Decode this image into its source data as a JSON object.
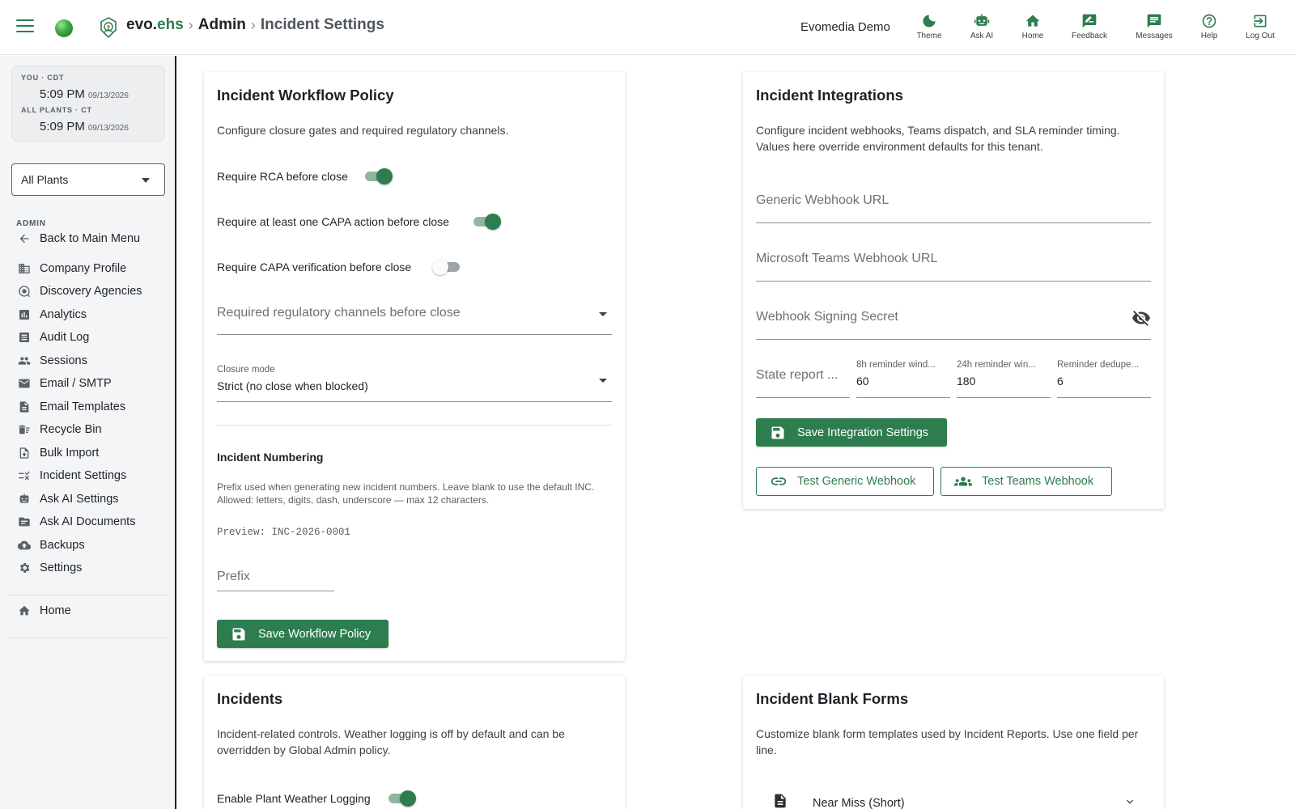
{
  "header": {
    "brand_prefix": "evo.",
    "brand_suffix": "ehs",
    "sep": "›",
    "crumb_admin": "Admin",
    "crumb_page": "Incident Settings",
    "tenant": "Evomedia Demo",
    "nav": [
      {
        "label": "Theme",
        "icon": "moon-icon"
      },
      {
        "label": "Ask AI",
        "icon": "robot-icon"
      },
      {
        "label": "Home",
        "icon": "home-icon"
      },
      {
        "label": "Feedback",
        "icon": "feedback-icon"
      },
      {
        "label": "Messages",
        "icon": "message-icon"
      },
      {
        "label": "Help",
        "icon": "help-icon"
      },
      {
        "label": "Log Out",
        "icon": "logout-icon"
      }
    ]
  },
  "sidebar": {
    "clock": {
      "you_label": "YOU · CDT",
      "you_time": "5:09 PM",
      "you_date": "09/13/2026",
      "plants_label": "ALL PLANTS · CT",
      "plants_time": "5:09 PM",
      "plants_date": "09/13/2026"
    },
    "plant_select": "All Plants",
    "section_label": "ADMIN",
    "back": "Back to Main Menu",
    "items": [
      {
        "label": "Company Profile",
        "icon": "building-icon"
      },
      {
        "label": "Discovery Agencies",
        "icon": "search-agency-icon"
      },
      {
        "label": "Analytics",
        "icon": "analytics-icon"
      },
      {
        "label": "Audit Log",
        "icon": "audit-log-icon"
      },
      {
        "label": "Sessions",
        "icon": "people-icon"
      },
      {
        "label": "Email / SMTP",
        "icon": "email-icon"
      },
      {
        "label": "Email Templates",
        "icon": "document-icon"
      },
      {
        "label": "Recycle Bin",
        "icon": "recycle-bin-icon"
      },
      {
        "label": "Bulk Import",
        "icon": "upload-icon"
      },
      {
        "label": "Incident Settings",
        "icon": "rule-icon"
      },
      {
        "label": "Ask AI Settings",
        "icon": "robot-icon"
      },
      {
        "label": "Ask AI Documents",
        "icon": "folder-icon"
      },
      {
        "label": "Backups",
        "icon": "cloud-upload-icon"
      },
      {
        "label": "Settings",
        "icon": "gear-icon"
      }
    ],
    "home": "Home"
  },
  "workflow": {
    "title": "Incident Workflow Policy",
    "description": "Configure closure gates and required regulatory channels.",
    "toggles": [
      {
        "label": "Require RCA before close",
        "on": true
      },
      {
        "label": "Require at least one CAPA action before close",
        "on": true
      },
      {
        "label": "Require CAPA verification before close",
        "on": false
      }
    ],
    "channels_placeholder": "Required regulatory channels before close",
    "closure_label": "Closure mode",
    "closure_value": "Strict (no close when blocked)",
    "numbering_title": "Incident Numbering",
    "numbering_help": "Prefix used when generating new incident numbers. Leave blank to use the default INC. Allowed: letters, digits, dash, underscore — max 12 characters.",
    "preview": "Preview: INC-2026-0001",
    "prefix_placeholder": "Prefix",
    "save_label": "Save Workflow Policy"
  },
  "integrations": {
    "title": "Incident Integrations",
    "description": "Configure incident webhooks, Teams dispatch, and SLA reminder timing. Values here override environment defaults for this tenant.",
    "generic_placeholder": "Generic Webhook URL",
    "teams_placeholder": "Microsoft Teams Webhook URL",
    "secret_placeholder": "Webhook Signing Secret",
    "state_report_placeholder": "State report ...",
    "reminder_8h_label": "8h reminder wind...",
    "reminder_8h_value": "60",
    "reminder_24h_label": "24h reminder win...",
    "reminder_24h_value": "180",
    "dedupe_label": "Reminder dedupe...",
    "dedupe_value": "6",
    "save_label": "Save Integration Settings",
    "test_generic": "Test Generic Webhook",
    "test_teams": "Test Teams Webhook"
  },
  "incidents": {
    "title": "Incidents",
    "description": "Incident-related controls. Weather logging is off by default and can be overridden by Global Admin policy.",
    "weather_label": "Enable Plant Weather Logging",
    "weather_on": true
  },
  "blank_forms": {
    "title": "Incident Blank Forms",
    "description": "Customize blank form templates used by Incident Reports. Use one field per line.",
    "first_form": "Near Miss (Short)"
  },
  "colors": {
    "accent": "#2e7d4f",
    "toggle_track": "#8fb79d"
  }
}
